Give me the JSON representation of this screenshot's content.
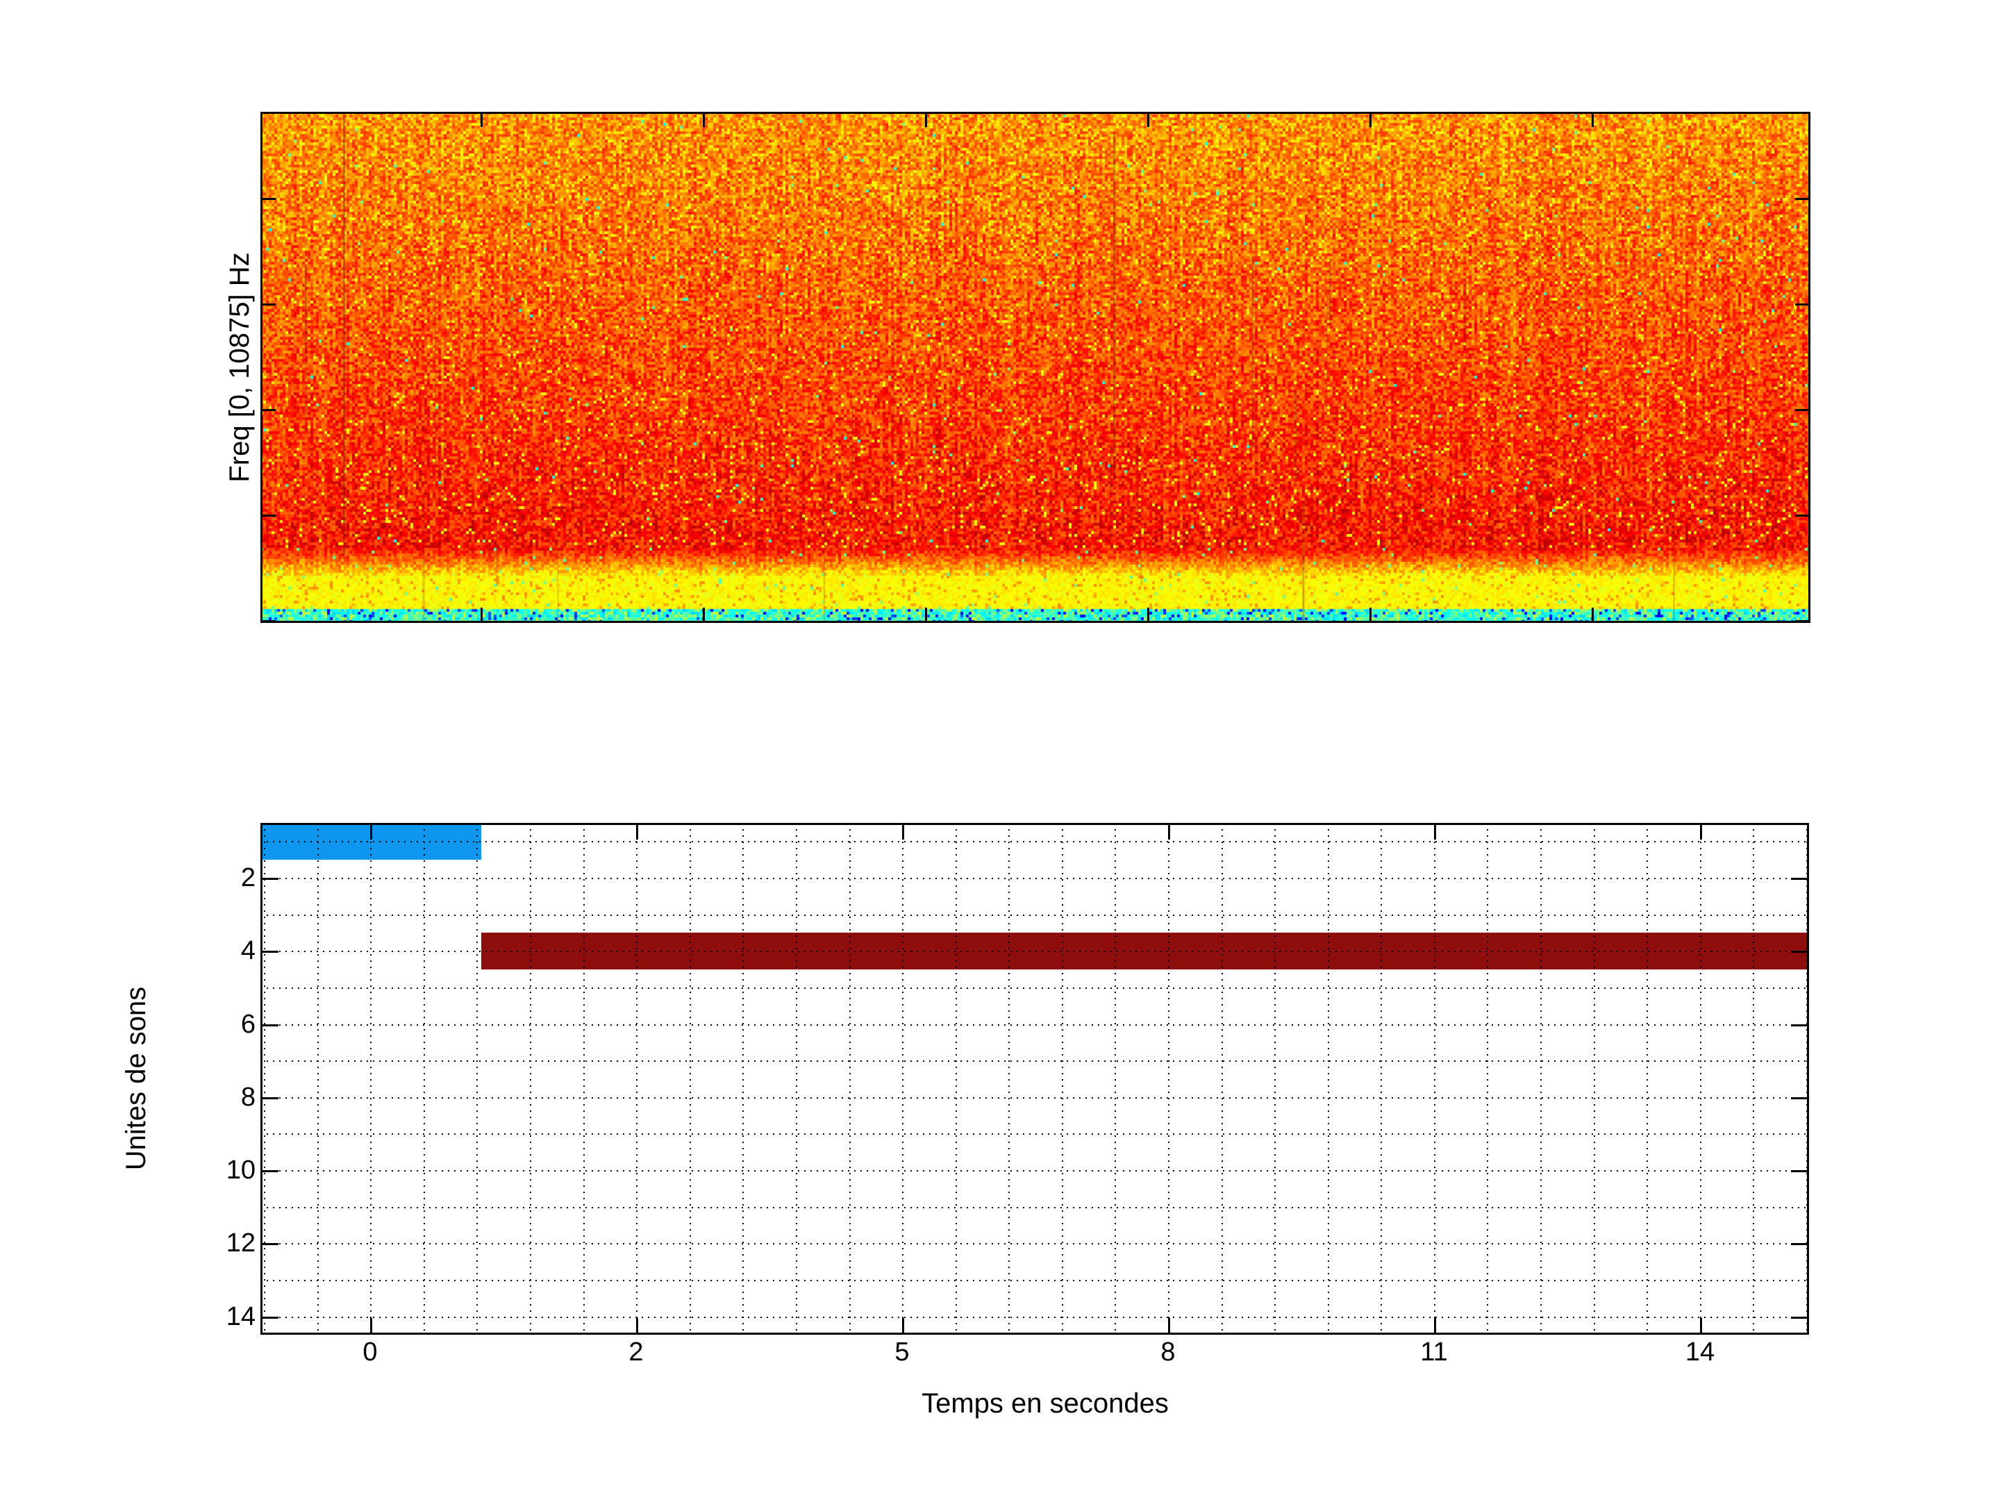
{
  "figure": {
    "background": "#FFFFFF",
    "style": "MATLAB-like figure, two stacked subplots, no titles"
  },
  "chart_data": [
    {
      "id": "spectrogram",
      "type": "heatmap",
      "title": "",
      "xlabel": "",
      "ylabel": "Freq [0, 10875] Hz",
      "freq_range_hz": [
        0,
        10875
      ],
      "colormap": "jet",
      "tick_labels_shown": false,
      "x_tick_count": 6,
      "y_tick_count": 5,
      "content_summary": "dense orange-red spectral noise with yellow speckles; band turns yellow near the bottom; thin cyan/blue strip along the bottom edge; a few faint dark vertical streaks",
      "palette": {
        "body_orange": "#FF5500",
        "body_red": "#F03000",
        "speckle_yellow": "#FFD700",
        "bottom_band_yellow": "#FFE000",
        "bottom_strip_cyan": "#30E8C8",
        "bottom_strip_blue": "#1040F0"
      }
    },
    {
      "id": "segmentation",
      "type": "gantt",
      "title": "",
      "xlabel": "Temps en secondes",
      "ylabel": "Unites de sons",
      "x_tick_labels": [
        "0",
        "2",
        "5",
        "8",
        "11",
        "14"
      ],
      "y_tick_labels": [
        "2",
        "4",
        "6",
        "8",
        "10",
        "12",
        "14"
      ],
      "ylim": [
        0.5,
        14.5
      ],
      "y_grid_step": 1,
      "x_minor_divisions_per_tick": 5,
      "grid": {
        "style": "dotted",
        "color": "#000000"
      },
      "bars": [
        {
          "name": "unite-1",
          "row": 1,
          "y_span": [
            0.5,
            1.5
          ],
          "x_span_frac": [
            0.0,
            0.1426
          ],
          "color": "#0F97F0"
        },
        {
          "name": "unite-4",
          "row": 4,
          "y_span": [
            3.5,
            4.5
          ],
          "x_span_frac": [
            0.1426,
            1.0
          ],
          "color": "#8E0E0E"
        }
      ]
    }
  ]
}
